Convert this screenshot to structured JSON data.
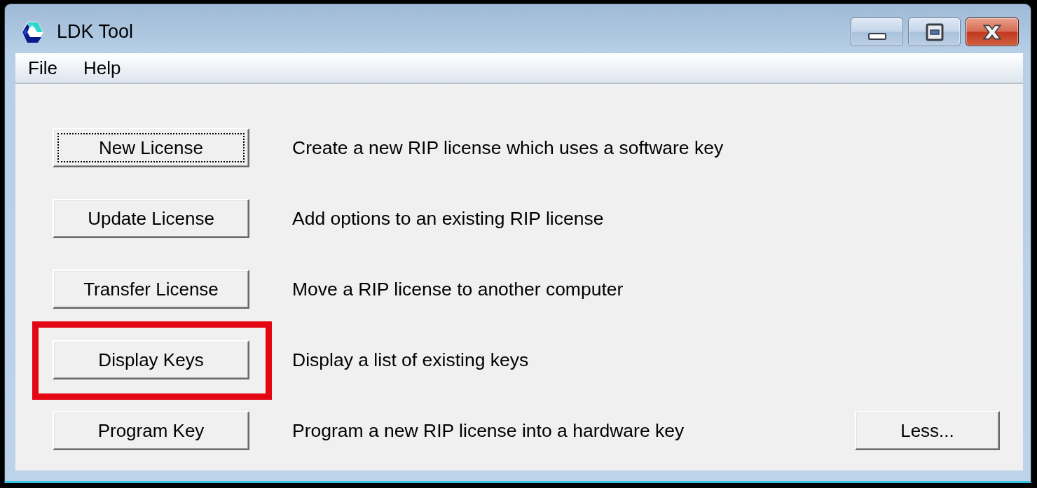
{
  "window": {
    "title": "LDK Tool"
  },
  "menu": [
    "File",
    "Help"
  ],
  "actions": [
    {
      "button": "New License",
      "description": "Create a new RIP license which uses a software key",
      "focused": true,
      "highlighted": false
    },
    {
      "button": "Update License",
      "description": "Add options to an existing RIP license",
      "focused": false,
      "highlighted": false
    },
    {
      "button": "Transfer License",
      "description": "Move a RIP license to another computer",
      "focused": false,
      "highlighted": false
    },
    {
      "button": "Display Keys",
      "description": "Display a list of existing keys",
      "focused": false,
      "highlighted": true
    },
    {
      "button": "Program Key",
      "description": "Program a new RIP license into a hardware key",
      "focused": false,
      "highlighted": false
    }
  ],
  "footer_button": {
    "label": "Less..."
  }
}
